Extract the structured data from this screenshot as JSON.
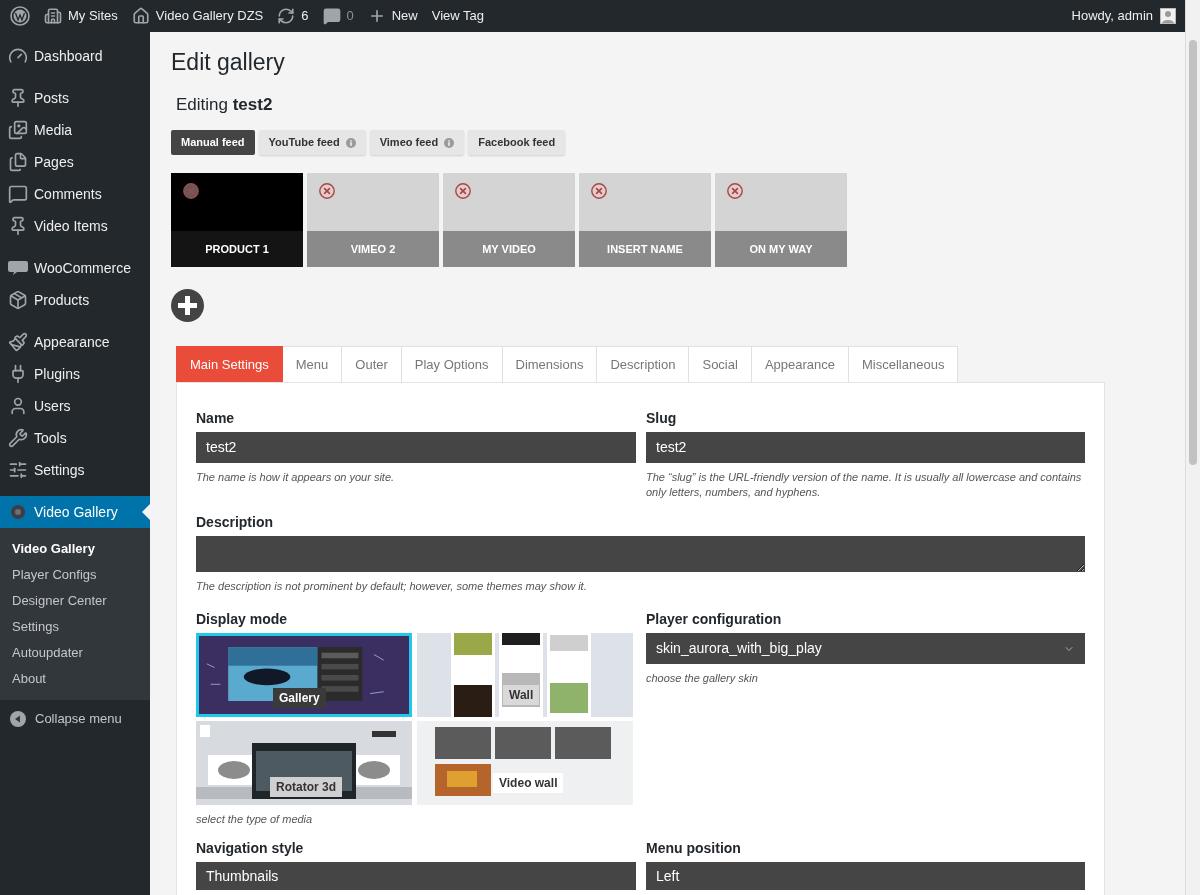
{
  "admin_bar": {
    "items": [
      {
        "label": "My Sites",
        "dimmed": false
      },
      {
        "label": "Video Gallery DZS",
        "dimmed": false
      },
      {
        "label": "6",
        "dimmed": false
      },
      {
        "label": "0",
        "dimmed": true
      },
      {
        "label": "New",
        "dimmed": false
      },
      {
        "label": "View Tag",
        "dimmed": false
      }
    ],
    "account": "Howdy, admin"
  },
  "sidebar": {
    "groups": [
      {
        "items": [
          {
            "label": "Dashboard",
            "selected": false
          }
        ]
      },
      {
        "items": [
          {
            "label": "Posts",
            "selected": false
          },
          {
            "label": "Media",
            "selected": false
          },
          {
            "label": "Pages",
            "selected": false
          },
          {
            "label": "Comments",
            "selected": false
          },
          {
            "label": "Video Items",
            "selected": false
          }
        ]
      },
      {
        "items": [
          {
            "label": "WooCommerce",
            "selected": false
          },
          {
            "label": "Products",
            "selected": false
          }
        ]
      },
      {
        "items": [
          {
            "label": "Appearance",
            "selected": false
          },
          {
            "label": "Plugins",
            "selected": false
          },
          {
            "label": "Users",
            "selected": false
          },
          {
            "label": "Tools",
            "selected": false
          },
          {
            "label": "Settings",
            "selected": false
          }
        ]
      },
      {
        "items": [
          {
            "label": "Video Gallery",
            "selected": true,
            "children": [
              {
                "label": "Video Gallery",
                "selected": true
              },
              {
                "label": "Player Configs",
                "selected": false
              },
              {
                "label": "Designer Center",
                "selected": false
              },
              {
                "label": "Settings",
                "selected": false
              },
              {
                "label": "Autoupdater",
                "selected": false
              },
              {
                "label": "About",
                "selected": false
              }
            ]
          }
        ]
      }
    ],
    "collapse": "Collapse menu"
  },
  "page": {
    "title": "Edit gallery",
    "subtitle": "Editing **test2**"
  },
  "feed_buttons": [
    {
      "label": "Manual feed",
      "selected": true,
      "info": false
    },
    {
      "label": "YouTube feed",
      "selected": false,
      "info": true
    },
    {
      "label": "Vimeo feed",
      "selected": false,
      "info": true
    },
    {
      "label": "Facebook feed",
      "selected": false,
      "info": false
    }
  ],
  "gallery_items": [
    {
      "label": "PRODUCT 1",
      "selected": true
    },
    {
      "label": "VIMEO 2",
      "selected": false
    },
    {
      "label": "MY VIDEO",
      "selected": false
    },
    {
      "label": "INSERT NAME",
      "selected": false
    },
    {
      "label": "ON MY WAY",
      "selected": false
    }
  ],
  "tabs": [
    {
      "label": "Main Settings",
      "selected": true
    },
    {
      "label": "Menu",
      "selected": false
    },
    {
      "label": "Outer",
      "selected": false
    },
    {
      "label": "Play Options",
      "selected": false
    },
    {
      "label": "Dimensions",
      "selected": false
    },
    {
      "label": "Description",
      "selected": false
    },
    {
      "label": "Social",
      "selected": false
    },
    {
      "label": "Appearance",
      "selected": false
    },
    {
      "label": "Miscellaneous",
      "selected": false
    }
  ],
  "settings": {
    "name": {
      "label": "Name",
      "value": "test2",
      "hint": "The name is how it appears on your site."
    },
    "slug": {
      "label": "Slug",
      "value": "test2",
      "hint": "The “slug” is the URL-friendly version of the name. It is usually all lowercase and contains only letters, numbers, and hyphens."
    },
    "description": {
      "label": "Description",
      "hint": "The description is not prominent by default; however, some themes may show it."
    },
    "display_mode": {
      "label": "Display mode",
      "options": [
        {
          "label": "Gallery",
          "selected": true
        },
        {
          "label": "Wall",
          "selected": false
        },
        {
          "label": "Rotator 3d",
          "selected": false
        },
        {
          "label": "Video wall",
          "selected": false
        }
      ],
      "hint": "select the type of media"
    },
    "player_configuration": {
      "label": "Player configuration",
      "value": "skin_aurora_with_big_play",
      "hint": "choose the gallery skin"
    },
    "navigation_style": {
      "label": "Navigation style",
      "value": "Thumbnails"
    },
    "menu_position": {
      "label": "Menu position",
      "value": "Left"
    }
  }
}
